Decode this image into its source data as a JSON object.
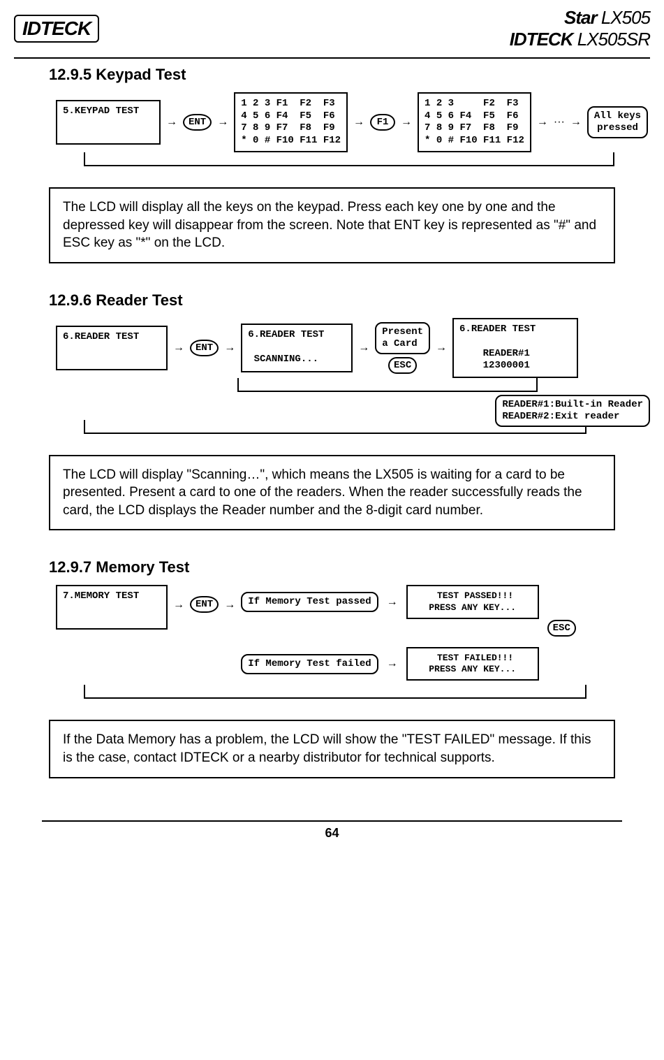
{
  "header": {
    "logo_left": "IDTECK",
    "logo_right_1a": "Star",
    "logo_right_1b": " LX505",
    "logo_right_2a": "IDTECK",
    "logo_right_2b": " LX505SR"
  },
  "sections": {
    "keypad": {
      "title": "12.9.5 Keypad Test",
      "menu": "5.KEYPAD TEST",
      "key_ent": "ENT",
      "grid_full": "1 2 3 F1  F2  F3\n4 5 6 F4  F5  F6\n7 8 9 F7  F8  F9\n* 0 # F10 F11 F12",
      "key_f1": "F1",
      "grid_after": "1 2 3     F2  F3\n4 5 6 F4  F5  F6\n7 8 9 F7  F8  F9\n* 0 # F10 F11 F12",
      "dots": "···",
      "all_keys": "All keys\npressed",
      "note": "The LCD will display all the keys on the keypad. Press each key one by one and the depressed key will disappear from the screen. Note that ENT key is represented as \"#\" and ESC key as \"*\" on the LCD."
    },
    "reader": {
      "title": "12.9.6 Reader Test",
      "menu": "6.READER TEST",
      "key_ent": "ENT",
      "scanning": "6.READER TEST\n\n SCANNING...",
      "present": "Present\na Card",
      "key_esc": "ESC",
      "result": "6.READER TEST\n\n    READER#1\n    12300001",
      "map": "READER#1:Built-in Reader\nREADER#2:Exit reader",
      "note": "The LCD will display \"Scanning…\", which means the LX505 is waiting for a card to be presented. Present a card to one of the readers. When the reader successfully reads the card, the LCD displays the Reader number and the 8-digit card number."
    },
    "memory": {
      "title": "12.9.7 Memory Test",
      "menu": "7.MEMORY TEST",
      "key_ent": "ENT",
      "cond_pass": "If Memory Test passed",
      "cond_fail": "If Memory Test failed",
      "res_pass": " TEST PASSED!!!\nPRESS ANY KEY...",
      "res_fail": " TEST FAILED!!!\nPRESS ANY KEY...",
      "key_esc": "ESC",
      "note": "If the Data Memory has a problem, the LCD will show the \"TEST FAILED\" message. If this is the case, contact IDTECK or a nearby distributor for technical supports."
    }
  },
  "page_number": "64"
}
